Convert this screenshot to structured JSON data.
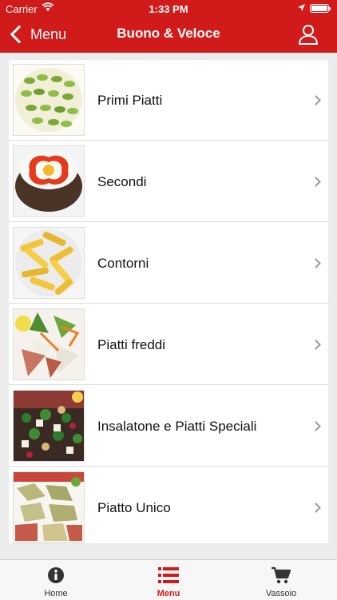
{
  "status_bar": {
    "carrier": "Carrier",
    "time": "1:33 PM"
  },
  "nav": {
    "back_label": "Menu",
    "title": "Buono & Veloce",
    "user_icon": "user-icon"
  },
  "menu_items": [
    {
      "label": "Primi Piatti"
    },
    {
      "label": "Secondi"
    },
    {
      "label": "Contorni"
    },
    {
      "label": "Piatti freddi"
    },
    {
      "label": "Insalatone e Piatti Speciali"
    },
    {
      "label": "Piatto Unico"
    }
  ],
  "tabbar": {
    "tabs": [
      {
        "label": "Home",
        "icon": "info-icon"
      },
      {
        "label": "Menu",
        "icon": "list-icon",
        "active": true
      },
      {
        "label": "Vassoio",
        "icon": "cart-icon"
      }
    ]
  },
  "colors": {
    "brand": "#d11a1a",
    "chevron": "#9a9a9a",
    "tab_inactive": "#333333"
  }
}
